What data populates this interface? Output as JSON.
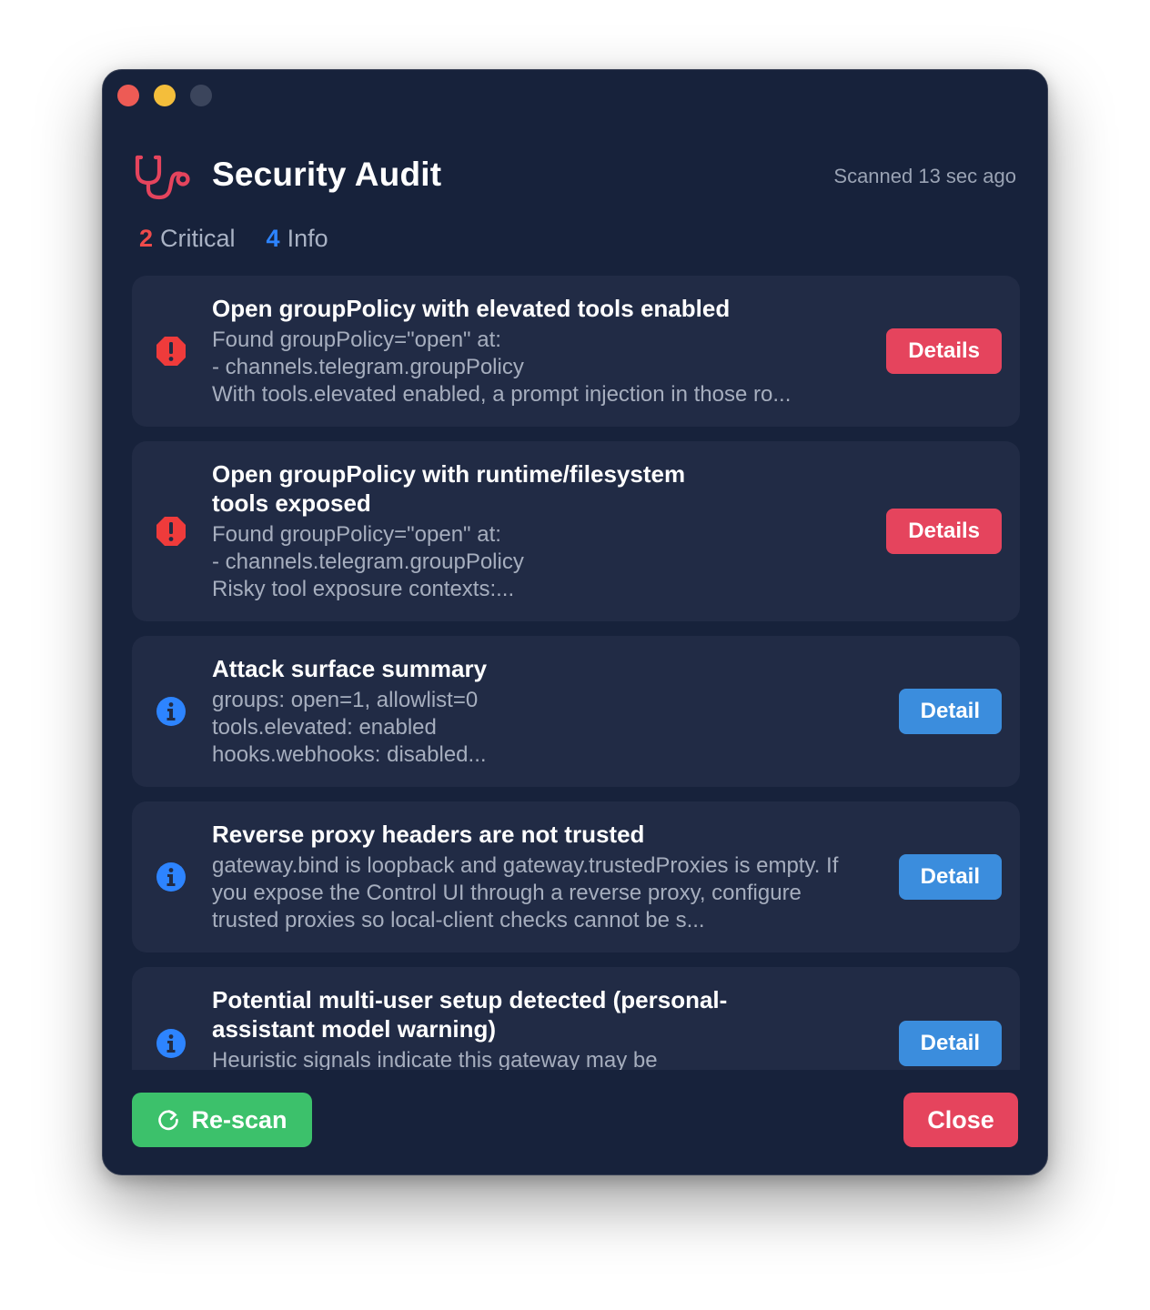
{
  "header": {
    "title": "Security Audit",
    "scanned": "Scanned 13 sec ago"
  },
  "counts": {
    "critical_num": "2",
    "critical_label": "Critical",
    "info_num": "4",
    "info_label": "Info"
  },
  "findings": [
    {
      "severity": "critical",
      "title": "Open groupPolicy with elevated tools enabled",
      "body": "Found groupPolicy=\"open\" at:\n- channels.telegram.groupPolicy\nWith tools.elevated enabled, a prompt injection in those ro...",
      "button": "Details"
    },
    {
      "severity": "critical",
      "title": "Open groupPolicy with runtime/filesystem tools exposed",
      "body": "Found groupPolicy=\"open\" at:\n- channels.telegram.groupPolicy\nRisky tool exposure contexts:...",
      "button": "Details"
    },
    {
      "severity": "info",
      "title": "Attack surface summary",
      "body": "groups: open=1, allowlist=0\ntools.elevated: enabled\nhooks.webhooks: disabled...",
      "button": "Detail"
    },
    {
      "severity": "info",
      "title": "Reverse proxy headers are not trusted",
      "body": "gateway.bind is loopback and gateway.trustedProxies is empty. If you expose the Control UI through a reverse proxy, configure trusted proxies so local-client checks cannot be s...",
      "button": "Detail"
    },
    {
      "severity": "info",
      "title": "Potential multi-user setup detected (personal-assistant model warning)",
      "body": "Heuristic signals indicate this gateway may be reachable by",
      "button": "Detail"
    }
  ],
  "footer": {
    "rescan_label": "Re-scan",
    "close_label": "Close"
  },
  "colors": {
    "window_bg": "#17223b",
    "card_bg": "#212b45",
    "critical": "#ef4b4b",
    "info": "#2d84ff",
    "danger_button": "#e5445d",
    "info_button": "#3b8ddd",
    "success_button": "#3cc16b"
  },
  "icons": {
    "app": "stethoscope-icon",
    "critical": "alert-octagon-icon",
    "info": "info-circle-icon",
    "rescan": "refresh-icon"
  }
}
